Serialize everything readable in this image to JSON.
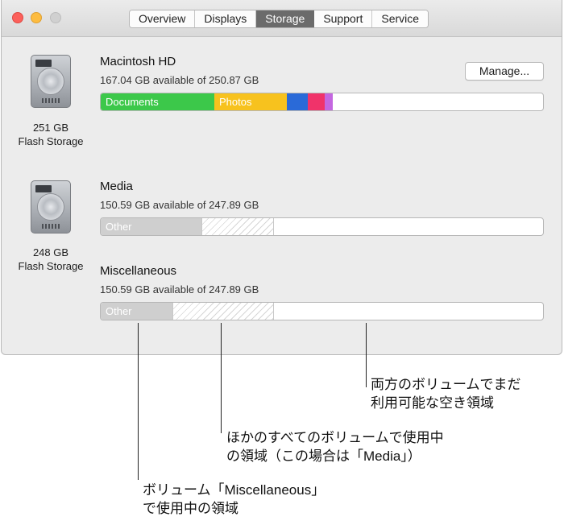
{
  "window": {
    "tabs": [
      {
        "label": "Overview",
        "active": false
      },
      {
        "label": "Displays",
        "active": false
      },
      {
        "label": "Storage",
        "active": true
      },
      {
        "label": "Support",
        "active": false
      },
      {
        "label": "Service",
        "active": false
      }
    ]
  },
  "disks": [
    {
      "capacity": "251 GB",
      "type": "Flash Storage",
      "icon": "hard-drive-icon"
    },
    {
      "capacity": "248 GB",
      "type": "Flash Storage",
      "icon": "hard-drive-icon"
    }
  ],
  "volumes": {
    "macintosh": {
      "name": "Macintosh HD",
      "info": "167.04 GB available of 250.87 GB",
      "manage_label": "Manage...",
      "segments": [
        {
          "label": "Documents",
          "color": "#3cc84a"
        },
        {
          "label": "Photos",
          "color": "#f7c21e"
        },
        {
          "label": "",
          "color": "#2a6ad8"
        },
        {
          "label": "",
          "color": "#f0336a"
        },
        {
          "label": "",
          "color": "#c467e0"
        }
      ]
    },
    "media": {
      "name": "Media",
      "info": "150.59 GB available of 247.89 GB",
      "other_label": "Other"
    },
    "misc": {
      "name": "Miscellaneous",
      "info": "150.59 GB available of 247.89 GB",
      "other_label": "Other"
    }
  },
  "callouts": {
    "free_space": {
      "line1": "両方のボリュームでまだ",
      "line2": "利用可能な空き領域"
    },
    "other_volumes": {
      "line1": "ほかのすべてのボリュームで使用中",
      "line2": "の領域（この場合は「Media」）"
    },
    "this_volume": {
      "line1": "ボリューム「Miscellaneous」",
      "line2": "で使用中の領域"
    }
  }
}
